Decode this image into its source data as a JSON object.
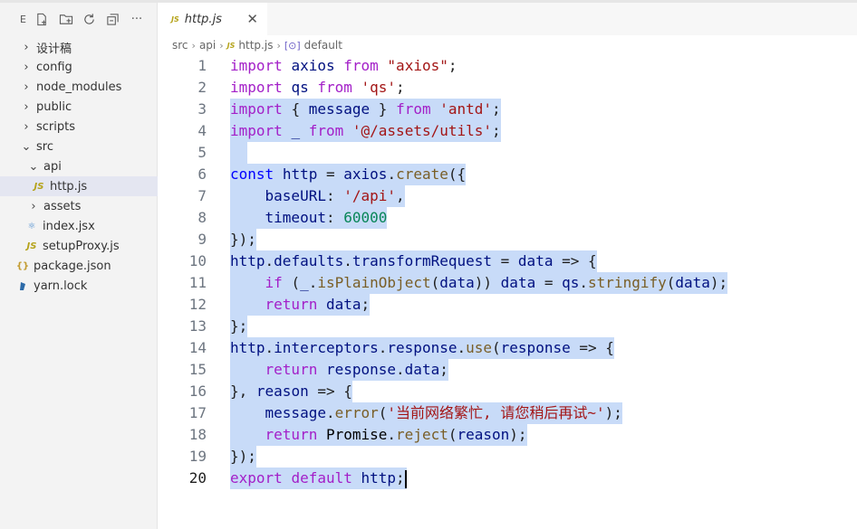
{
  "toolbar": {
    "explorer_letter": "E",
    "icons": [
      "new-file-icon",
      "new-folder-icon",
      "refresh-icon",
      "collapse-all-icon",
      "more-icon"
    ]
  },
  "explorer": {
    "items": [
      {
        "label": "设计稿",
        "type": "folder",
        "expanded": false,
        "depth": 0
      },
      {
        "label": "config",
        "type": "folder",
        "expanded": false,
        "depth": 0
      },
      {
        "label": "node_modules",
        "type": "folder",
        "expanded": false,
        "depth": 0
      },
      {
        "label": "public",
        "type": "folder",
        "expanded": false,
        "depth": 0
      },
      {
        "label": "scripts",
        "type": "folder",
        "expanded": false,
        "depth": 0
      },
      {
        "label": "src",
        "type": "folder",
        "expanded": true,
        "depth": 0
      },
      {
        "label": "api",
        "type": "folder",
        "expanded": true,
        "depth": 1
      },
      {
        "label": "http.js",
        "type": "js",
        "depth": 2,
        "selected": true
      },
      {
        "label": "assets",
        "type": "folder",
        "expanded": false,
        "depth": 1
      },
      {
        "label": "index.jsx",
        "type": "jsx",
        "depth": 1
      },
      {
        "label": "setupProxy.js",
        "type": "js",
        "depth": 1
      },
      {
        "label": "package.json",
        "type": "json",
        "depth": 0
      },
      {
        "label": "yarn.lock",
        "type": "yarn",
        "depth": 0
      }
    ]
  },
  "tab": {
    "icon_text": "JS",
    "label": "http.js",
    "close": "✕"
  },
  "breadcrumb": {
    "parts": [
      "src",
      "api",
      "http.js",
      "default"
    ],
    "js_icon_text": "JS",
    "symbol_icon_text": "[⊙]"
  },
  "colors": {
    "selection": "#c8dbf8",
    "keyword": "#a31fc8",
    "string": "#a31515",
    "function": "#795e26",
    "variable": "#001080"
  },
  "code": {
    "active_line": 20,
    "lines": [
      {
        "n": "1",
        "text": "import axios from \"axios\";"
      },
      {
        "n": "2",
        "text": "import qs from 'qs';"
      },
      {
        "n": "3",
        "text": "import { message } from 'antd';"
      },
      {
        "n": "4",
        "text": "import _ from '@/assets/utils';"
      },
      {
        "n": "5",
        "text": ""
      },
      {
        "n": "6",
        "text": "const http = axios.create({"
      },
      {
        "n": "7",
        "text": "    baseURL: '/api',"
      },
      {
        "n": "8",
        "text": "    timeout: 60000"
      },
      {
        "n": "9",
        "text": "});"
      },
      {
        "n": "10",
        "text": "http.defaults.transformRequest = data => {"
      },
      {
        "n": "11",
        "text": "    if (_.isPlainObject(data)) data = qs.stringify(data);"
      },
      {
        "n": "12",
        "text": "    return data;"
      },
      {
        "n": "13",
        "text": "};"
      },
      {
        "n": "14",
        "text": "http.interceptors.response.use(response => {"
      },
      {
        "n": "15",
        "text": "    return response.data;"
      },
      {
        "n": "16",
        "text": "}, reason => {"
      },
      {
        "n": "17",
        "text": "    message.error('当前网络繁忙, 请您稍后再试~');"
      },
      {
        "n": "18",
        "text": "    return Promise.reject(reason);"
      },
      {
        "n": "19",
        "text": "});"
      },
      {
        "n": "20",
        "text": "export default http;"
      }
    ]
  }
}
